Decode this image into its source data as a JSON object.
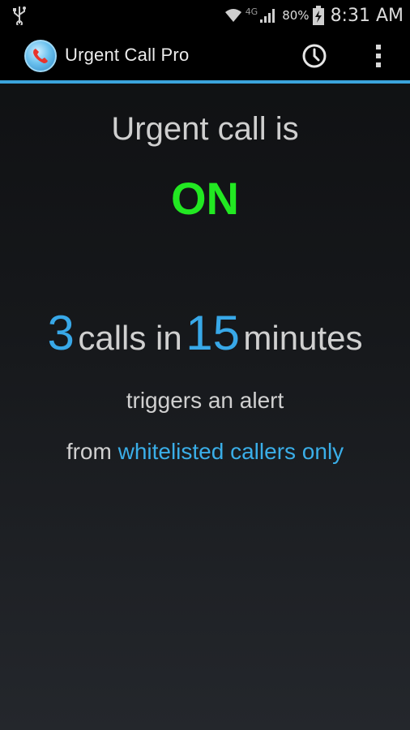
{
  "status_bar": {
    "network": "4G",
    "battery_percent": "80%",
    "time": "8:31 AM",
    "icons": [
      "usb-icon",
      "wifi-icon",
      "signal-icon",
      "battery-charging-icon"
    ]
  },
  "action_bar": {
    "title": "Urgent Call Pro",
    "icons": [
      "app-logo-phone-icon",
      "history-clock-icon",
      "overflow-menu-icon"
    ]
  },
  "main": {
    "status_prefix": "Urgent call is",
    "status_value": "ON",
    "rule": {
      "call_count": "3",
      "mid_text": "calls in",
      "minutes": "15",
      "suffix": "minutes"
    },
    "trigger_text": "triggers an alert",
    "from_prefix": "from",
    "caller_filter": "whitelisted callers only"
  },
  "colors": {
    "accent_blue": "#3ba4dc",
    "on_green": "#22e822",
    "background_top": "#0e0f11",
    "background_bottom": "#24272c"
  }
}
